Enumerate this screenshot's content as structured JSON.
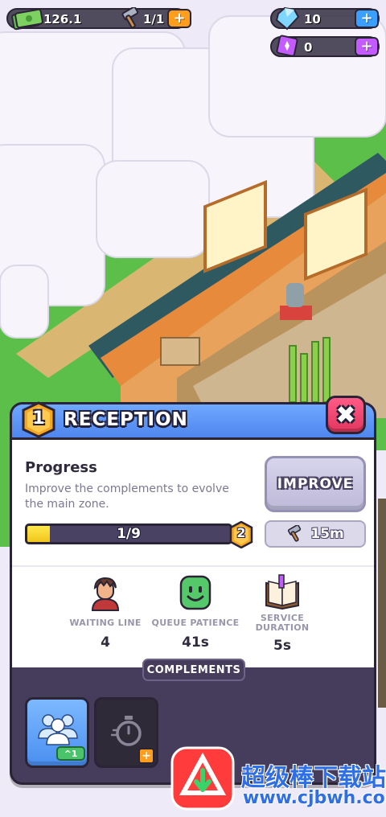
{
  "hud": {
    "cash": "126.1",
    "hammers": "1/1",
    "gems": "10",
    "purple_gems": "0"
  },
  "panel": {
    "level": "1",
    "title": "RECEPTION",
    "progress_title": "Progress",
    "progress_desc": "Improve the complements to evolve the main zone.",
    "progress_text": "1/9",
    "progress_fraction": 0.11,
    "next_level": "2",
    "improve_label": "IMPROVE",
    "cost_time": "15m",
    "stats": [
      {
        "label": "WAITING LINE",
        "value": "4",
        "icon": "customer-icon"
      },
      {
        "label": "QUEUE PATIENCE",
        "value": "41s",
        "icon": "smile-face-icon"
      },
      {
        "label": "SERVICE DURATION",
        "value": "5s",
        "icon": "book-icon"
      }
    ],
    "section_label": "COMPLEMENTS",
    "cards": [
      {
        "name": "queue-complement",
        "icon": "people-icon",
        "tag": "^1"
      },
      {
        "name": "timer-complement",
        "icon": "stopwatch-icon"
      }
    ]
  },
  "watermark": {
    "text": "超级棒下载站",
    "url": "www.cjbwh.com"
  },
  "colors": {
    "accent_blue": "#4f86ee",
    "close_pink": "#e2365e",
    "progress_yellow": "#f1c61b",
    "badge_orange": "#f5a623"
  }
}
